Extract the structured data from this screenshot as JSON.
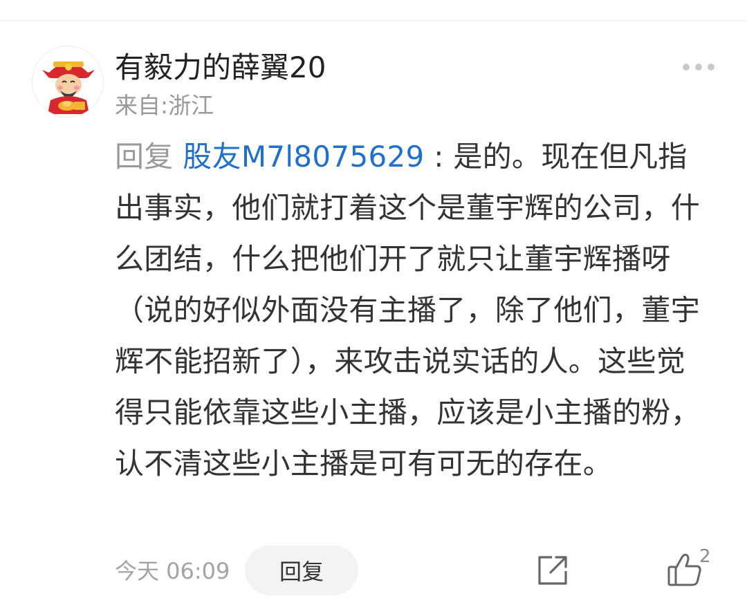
{
  "comment": {
    "username": "有毅力的薛翼20",
    "location": "来自:浙江",
    "reply_prefix": "回复 ",
    "mention": "股友M7l8075629",
    "separator": " : ",
    "text": "是的。现在但凡指出事实，他们就打着这个是董宇辉的公司，什么团结，什么把他们开了就只让董宇辉播呀（说的好似外面没有主播了，除了他们，董宇辉不能招新了），来攻击说实话的人。这些觉得只能依靠这些小主播，应该是小主播的粉，认不清这些小主播是可有可无的存在。",
    "timestamp": "今天 06:09",
    "reply_label": "回复",
    "like_count": "2"
  },
  "icons": {
    "avatar": "fortune-god-avatar",
    "more": "more-dots-icon",
    "share": "share-icon",
    "like": "thumbs-up-icon"
  },
  "colors": {
    "mention": "#1f6fd0",
    "muted_text": "#9a9a9a",
    "body_text": "#333333",
    "reply_button_bg": "#f3f3f3"
  }
}
